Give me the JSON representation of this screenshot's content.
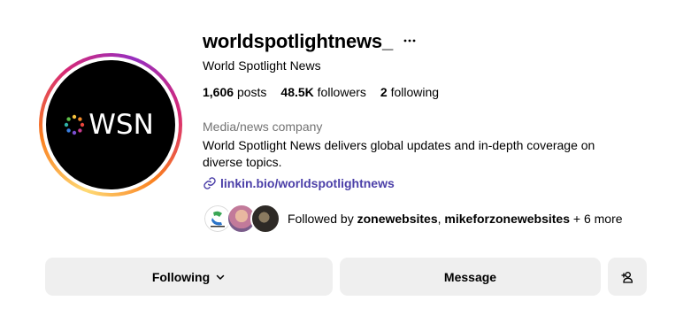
{
  "profile": {
    "username": "worldspotlightnews_",
    "full_name": "World Spotlight News",
    "avatar_logo_text": "WSN",
    "stats": {
      "posts_count": "1,606",
      "posts_label": "posts",
      "followers_count": "48.5K",
      "followers_label": "followers",
      "following_count": "2",
      "following_label": "following"
    },
    "category": "Media/news company",
    "bio": "World Spotlight News delivers global updates and in-depth coverage on diverse topics.",
    "link": "linkin.bio/worldspotlightnews",
    "followed_by": {
      "prefix": "Followed by",
      "user1": "zonewebsites",
      "separator": ",",
      "user2": "mikeforzonewebsites",
      "suffix": "+ 6 more"
    }
  },
  "actions": {
    "following_label": "Following",
    "message_label": "Message"
  },
  "icons": {
    "more": "more-horizontal-icon",
    "link": "link-icon",
    "chevron": "chevron-down-icon",
    "add_user": "add-user-icon"
  },
  "colors": {
    "link": "#4b3fa8",
    "button_bg": "#efefef",
    "secondary_text": "#737373"
  }
}
